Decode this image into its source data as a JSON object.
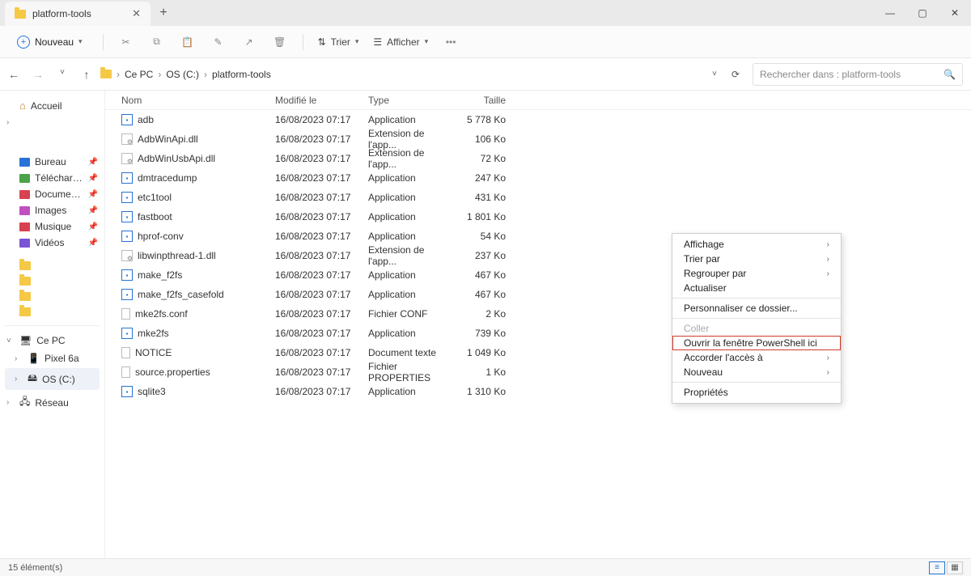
{
  "tab": {
    "title": "platform-tools"
  },
  "toolbar": {
    "new_label": "Nouveau",
    "sort_label": "Trier",
    "view_label": "Afficher"
  },
  "breadcrumb": {
    "parts": [
      "Ce PC",
      "OS (C:)",
      "platform-tools"
    ]
  },
  "search": {
    "placeholder": "Rechercher dans : platform-tools"
  },
  "sidebar": {
    "home": "Accueil",
    "quick": [
      {
        "label": "Bureau",
        "color": "#2673d8"
      },
      {
        "label": "Téléchargements",
        "color": "#4aa34a"
      },
      {
        "label": "Documents",
        "color": "#d8414f"
      },
      {
        "label": "Images",
        "color": "#c04fbf"
      },
      {
        "label": "Musique",
        "color": "#d8414f"
      },
      {
        "label": "Vidéos",
        "color": "#7a53d6"
      }
    ],
    "thispc": "Ce PC",
    "devices": [
      "Pixel 6a",
      "OS (C:)"
    ],
    "network": "Réseau"
  },
  "columns": {
    "name": "Nom",
    "modified": "Modifié le",
    "type": "Type",
    "size": "Taille"
  },
  "files": [
    {
      "name": "adb",
      "mod": "16/08/2023 07:17",
      "type": "Application",
      "size": "5 778 Ko",
      "icon": "exe"
    },
    {
      "name": "AdbWinApi.dll",
      "mod": "16/08/2023 07:17",
      "type": "Extension de l'app...",
      "size": "106 Ko",
      "icon": "dll"
    },
    {
      "name": "AdbWinUsbApi.dll",
      "mod": "16/08/2023 07:17",
      "type": "Extension de l'app...",
      "size": "72 Ko",
      "icon": "dll"
    },
    {
      "name": "dmtracedump",
      "mod": "16/08/2023 07:17",
      "type": "Application",
      "size": "247 Ko",
      "icon": "exe"
    },
    {
      "name": "etc1tool",
      "mod": "16/08/2023 07:17",
      "type": "Application",
      "size": "431 Ko",
      "icon": "exe"
    },
    {
      "name": "fastboot",
      "mod": "16/08/2023 07:17",
      "type": "Application",
      "size": "1 801 Ko",
      "icon": "exe"
    },
    {
      "name": "hprof-conv",
      "mod": "16/08/2023 07:17",
      "type": "Application",
      "size": "54 Ko",
      "icon": "exe"
    },
    {
      "name": "libwinpthread-1.dll",
      "mod": "16/08/2023 07:17",
      "type": "Extension de l'app...",
      "size": "237 Ko",
      "icon": "dll"
    },
    {
      "name": "make_f2fs",
      "mod": "16/08/2023 07:17",
      "type": "Application",
      "size": "467 Ko",
      "icon": "exe"
    },
    {
      "name": "make_f2fs_casefold",
      "mod": "16/08/2023 07:17",
      "type": "Application",
      "size": "467 Ko",
      "icon": "exe"
    },
    {
      "name": "mke2fs.conf",
      "mod": "16/08/2023 07:17",
      "type": "Fichier CONF",
      "size": "2 Ko",
      "icon": "doc"
    },
    {
      "name": "mke2fs",
      "mod": "16/08/2023 07:17",
      "type": "Application",
      "size": "739 Ko",
      "icon": "exe"
    },
    {
      "name": "NOTICE",
      "mod": "16/08/2023 07:17",
      "type": "Document texte",
      "size": "1 049 Ko",
      "icon": "doc"
    },
    {
      "name": "source.properties",
      "mod": "16/08/2023 07:17",
      "type": "Fichier PROPERTIES",
      "size": "1 Ko",
      "icon": "doc"
    },
    {
      "name": "sqlite3",
      "mod": "16/08/2023 07:17",
      "type": "Application",
      "size": "1 310 Ko",
      "icon": "exe"
    }
  ],
  "context": {
    "items": [
      {
        "label": "Affichage",
        "sub": true
      },
      {
        "label": "Trier par",
        "sub": true
      },
      {
        "label": "Regrouper par",
        "sub": true
      },
      {
        "label": "Actualiser"
      },
      {
        "sep": true
      },
      {
        "label": "Personnaliser ce dossier..."
      },
      {
        "sep": true
      },
      {
        "label": "Coller",
        "disabled": true
      },
      {
        "label": "Ouvrir la fenêtre PowerShell ici",
        "highlight": true
      },
      {
        "label": "Accorder l'accès à",
        "sub": true
      },
      {
        "label": "Nouveau",
        "sub": true
      },
      {
        "sep": true
      },
      {
        "label": "Propriétés"
      }
    ]
  },
  "status": {
    "count": "15 élément(s)"
  }
}
